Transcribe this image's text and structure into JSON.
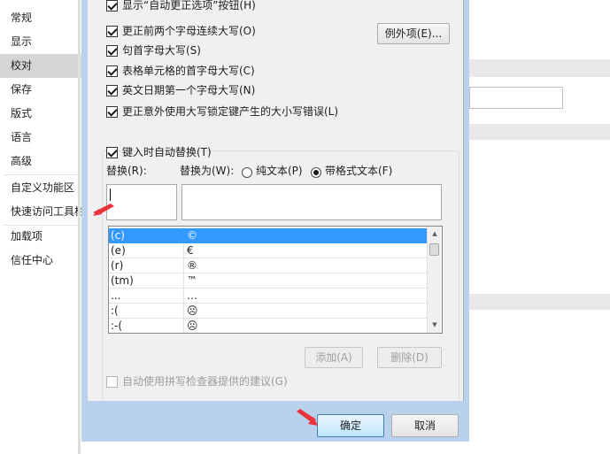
{
  "sidebar": {
    "items": [
      {
        "label": "常规"
      },
      {
        "label": "显示"
      },
      {
        "label": "校对"
      },
      {
        "label": "保存"
      },
      {
        "label": "版式"
      },
      {
        "label": "语言"
      },
      {
        "label": "高级"
      },
      {
        "label": "自定义功能区"
      },
      {
        "label": "快速访问工具栏"
      },
      {
        "label": "加载项"
      },
      {
        "label": "信任中心"
      }
    ],
    "active_index": 2
  },
  "dialog": {
    "options": [
      {
        "label": "显示“自动更正选项”按钮(H)",
        "checked": true
      },
      {
        "label": "更正前两个字母连续大写(O)",
        "checked": true
      },
      {
        "label": "句首字母大写(S)",
        "checked": true
      },
      {
        "label": "表格单元格的首字母大写(C)",
        "checked": true
      },
      {
        "label": "英文日期第一个字母大写(N)",
        "checked": true
      },
      {
        "label": "更正意外使用大写锁定键产生的大小写错误(L)",
        "checked": true
      }
    ],
    "exceptions_button": "例外项(E)...",
    "replace_as_typing": {
      "label": "键入时自动替换(T)",
      "checked": true
    },
    "replace_label": "替换(R):",
    "with_label": "替换为(W):",
    "radio_plain": {
      "label": "纯文本(P)",
      "selected": false
    },
    "radio_formatted": {
      "label": "带格式文本(F)",
      "selected": true
    },
    "replace_value": "",
    "with_value": "",
    "table": {
      "rows": [
        {
          "from": "(c)",
          "to": "©"
        },
        {
          "from": "(e)",
          "to": "€"
        },
        {
          "from": "(r)",
          "to": "®"
        },
        {
          "from": "(tm)",
          "to": "™"
        },
        {
          "from": "...",
          "to": "…"
        },
        {
          "from": ":(",
          "to": "☹"
        },
        {
          "from": ":-(",
          "to": "☹"
        }
      ],
      "selected_index": 0
    },
    "add_button": "添加(A)",
    "delete_button": "删除(D)",
    "spellcheck_suggest": {
      "label": "自动使用拼写检查器提供的建议(G)",
      "checked": false
    },
    "ok_button": "确定",
    "cancel_button": "取消"
  },
  "colors": {
    "selection": "#3399ff",
    "dialog_frame": "#b9d1ea",
    "pointer_arrow": "#e8333a",
    "active_sidebar": "#d5d5d5"
  }
}
